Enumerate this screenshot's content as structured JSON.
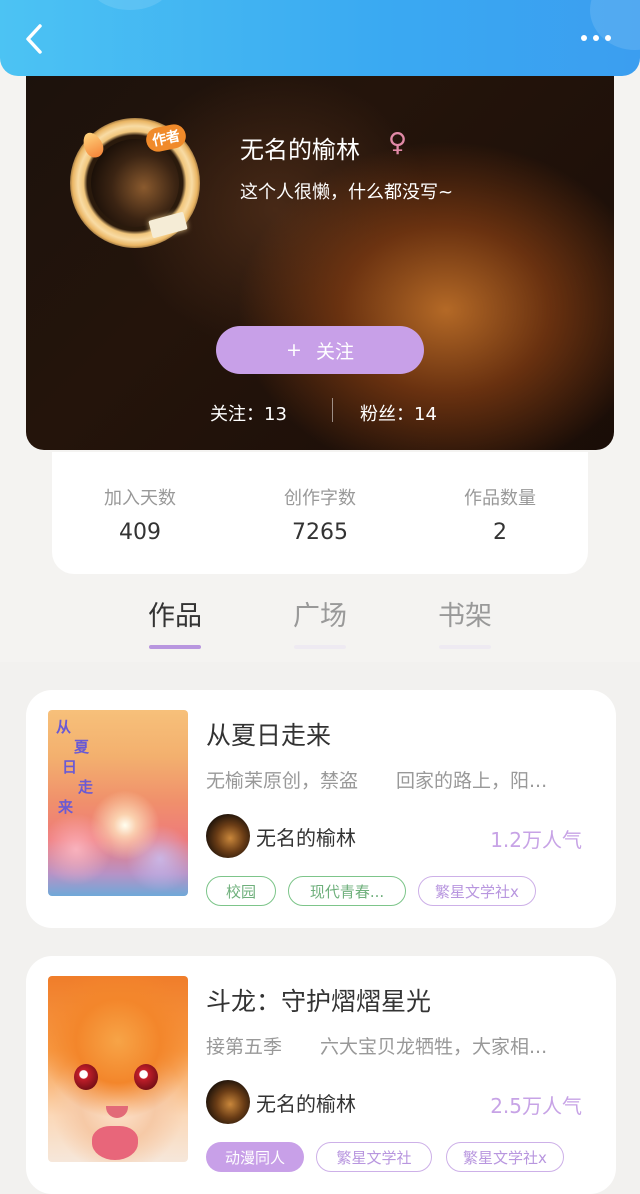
{
  "header": {
    "back_icon": "chevron-left-icon",
    "more_icon": "more-horizontal-icon",
    "color": "#3aa9f2"
  },
  "profile": {
    "avatar_tag": "作者",
    "username": "无名的榆林",
    "gender_symbol": "♀",
    "bio": "这个人很懒，什么都没写~",
    "follow_button": {
      "plus": "+",
      "label": "关注"
    },
    "following_label": "关注：13",
    "followers_label": "粉丝：14"
  },
  "stats": [
    {
      "label": "加入天数",
      "value": "409"
    },
    {
      "label": "创作字数",
      "value": "7265"
    },
    {
      "label": "作品数量",
      "value": "2"
    }
  ],
  "tabs": [
    {
      "label": "作品",
      "active": true
    },
    {
      "label": "广场",
      "active": false
    },
    {
      "label": "书架",
      "active": false
    }
  ],
  "works": [
    {
      "title": "从夏日走来",
      "desc_left": "无榆茉原创，禁盗",
      "desc_right": "回家的路上，阳...",
      "cover_text": [
        "从",
        "夏",
        "日",
        "走",
        "来"
      ],
      "author": "无名的榆林",
      "popularity": "1.2万人气",
      "tags": [
        {
          "label": "校园",
          "style": "green"
        },
        {
          "label": "现代青春...",
          "style": "green"
        },
        {
          "label": "繁星文学社x",
          "style": "purple"
        }
      ]
    },
    {
      "title": "斗龙：守护熠熠星光",
      "desc_left": "接第五季",
      "desc_right": "六大宝贝龙牺牲，大家相...",
      "author": "无名的榆林",
      "popularity": "2.5万人气",
      "tags": [
        {
          "label": "动漫同人",
          "style": "filled"
        },
        {
          "label": "繁星文学社",
          "style": "purple"
        },
        {
          "label": "繁星文学社x",
          "style": "purple"
        }
      ]
    }
  ],
  "accent_purple": "#c8a0e8"
}
